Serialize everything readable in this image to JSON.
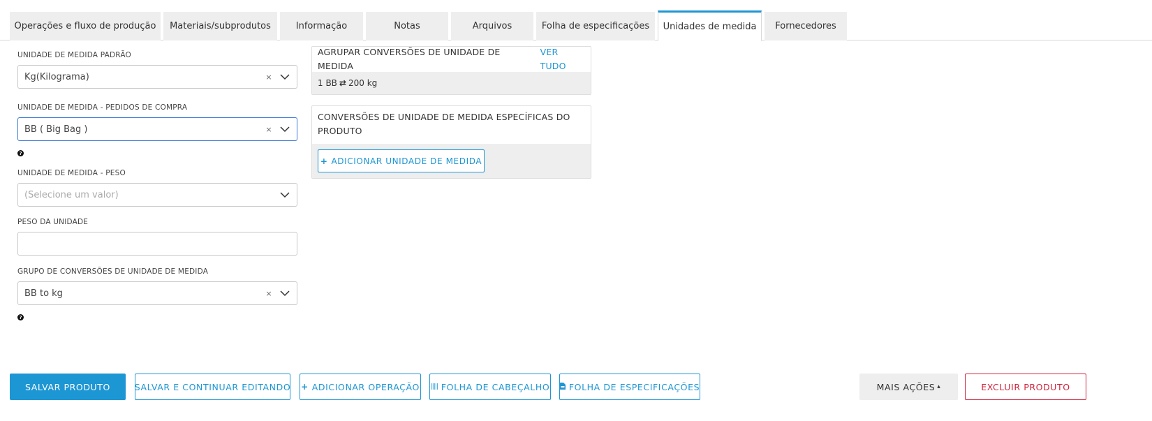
{
  "tabs": [
    {
      "label": "Operações e fluxo de produção"
    },
    {
      "label": "Materiais/subprodutos"
    },
    {
      "label": "Informação"
    },
    {
      "label": "Notas"
    },
    {
      "label": "Arquivos"
    },
    {
      "label": "Folha de especificações"
    },
    {
      "label": "Unidades de medida",
      "active": true
    },
    {
      "label": "Fornecedores"
    }
  ],
  "form": {
    "default_uom": {
      "label": "UNIDADE DE MEDIDA PADRÃO",
      "value": "Kg(Kilograma)",
      "clear": "×"
    },
    "purchase_uom": {
      "label": "UNIDADE DE MEDIDA - PEDIDOS DE COMPRA",
      "value": "BB ( Big Bag )",
      "clear": "×"
    },
    "weight_uom": {
      "label": "UNIDADE DE MEDIDA - PESO",
      "placeholder": "(Selecione um valor)"
    },
    "unit_weight": {
      "label": "PESO DA UNIDADE",
      "value": ""
    },
    "conversion_group": {
      "label": "GRUPO DE CONVERSÕES DE UNIDADE DE MEDIDA",
      "value": "BB to kg",
      "clear": "×"
    },
    "help_glyph": "?"
  },
  "group_conversions": {
    "title": "AGRUPAR CONVERSÕES DE UNIDADE DE MEDIDA",
    "view_all": "VER TUDO",
    "conversion": {
      "left": "1 BB",
      "arrow": "⇄",
      "right": "200 kg"
    }
  },
  "product_conversions": {
    "title": "CONVERSÕES DE UNIDADE DE MEDIDA ESPECÍFICAS DO PRODUTO",
    "add_button": {
      "icon": "+",
      "label": "ADICIONAR UNIDADE DE MEDIDA"
    }
  },
  "actions": {
    "save_product": "SALVAR PRODUTO",
    "save_continue": "SALVAR E CONTINUAR EDITANDO",
    "add_operation": {
      "icon": "+",
      "label": "ADICIONAR OPERAÇÃO"
    },
    "header_sheet": {
      "icon": "|||||",
      "label": "FOLHA DE CABEÇALHO"
    },
    "spec_sheet": {
      "icon": "file-icon",
      "label": "FOLHA DE ESPECIFICAÇÕES"
    },
    "more_actions": {
      "label": "MAIS AÇÕES",
      "caret": "▴"
    },
    "delete_product": "EXCLUIR PRODUTO"
  },
  "colors": {
    "accent": "#1d96d4",
    "danger": "#d0243d",
    "focus": "#3a78d6",
    "tab_bg": "#eeeeee"
  }
}
